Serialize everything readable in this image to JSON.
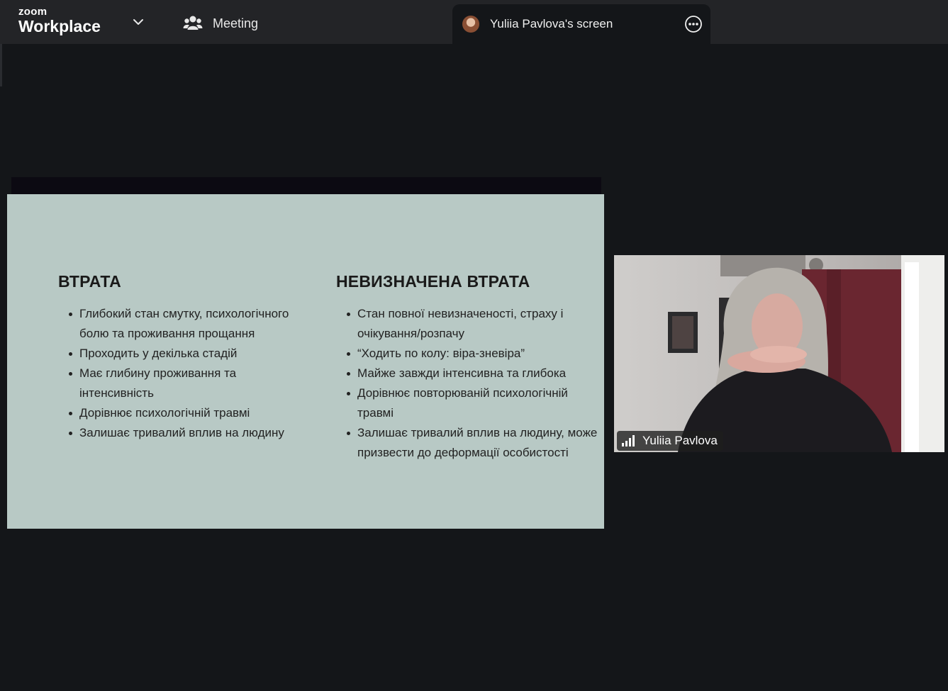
{
  "app": {
    "brand_top": "zoom",
    "brand_bottom": "Workplace"
  },
  "toolbar": {
    "meeting_label": "Meeting",
    "screen_tab_title": "Yuliia Pavlova's screen"
  },
  "slide": {
    "left": {
      "heading": "ВТРАТА",
      "items": [
        "Глибокий стан смутку, психологічного болю та проживання прощання",
        "Проходить у декілька стадій",
        "Має глибину проживання та інтенсивність",
        "Дорівнює психологічній травмі",
        "Залишає тривалий вплив на людину"
      ]
    },
    "right": {
      "heading": "НЕВИЗНАЧЕНА ВТРАТА",
      "items": [
        "Стан повної невизначеності, страху і очікування/розпачу",
        "“Ходить по колу: віра-зневіра”",
        "Майже завжди інтенсивна та глибока",
        "Дорівнює повторюваній психологічній травмі",
        "Залишає тривалий вплив на людину, може призвести до деформації особистості"
      ]
    }
  },
  "video": {
    "participant_name": "Yuliia Pavlova"
  },
  "colors": {
    "background": "#141619",
    "topbar": "#232427",
    "slide_bg": "#b8c9c5"
  },
  "icons": {
    "chevron": "chevron-down-icon",
    "meeting": "participants-icon",
    "more": "more-options-icon",
    "signal": "signal-strength-icon"
  }
}
